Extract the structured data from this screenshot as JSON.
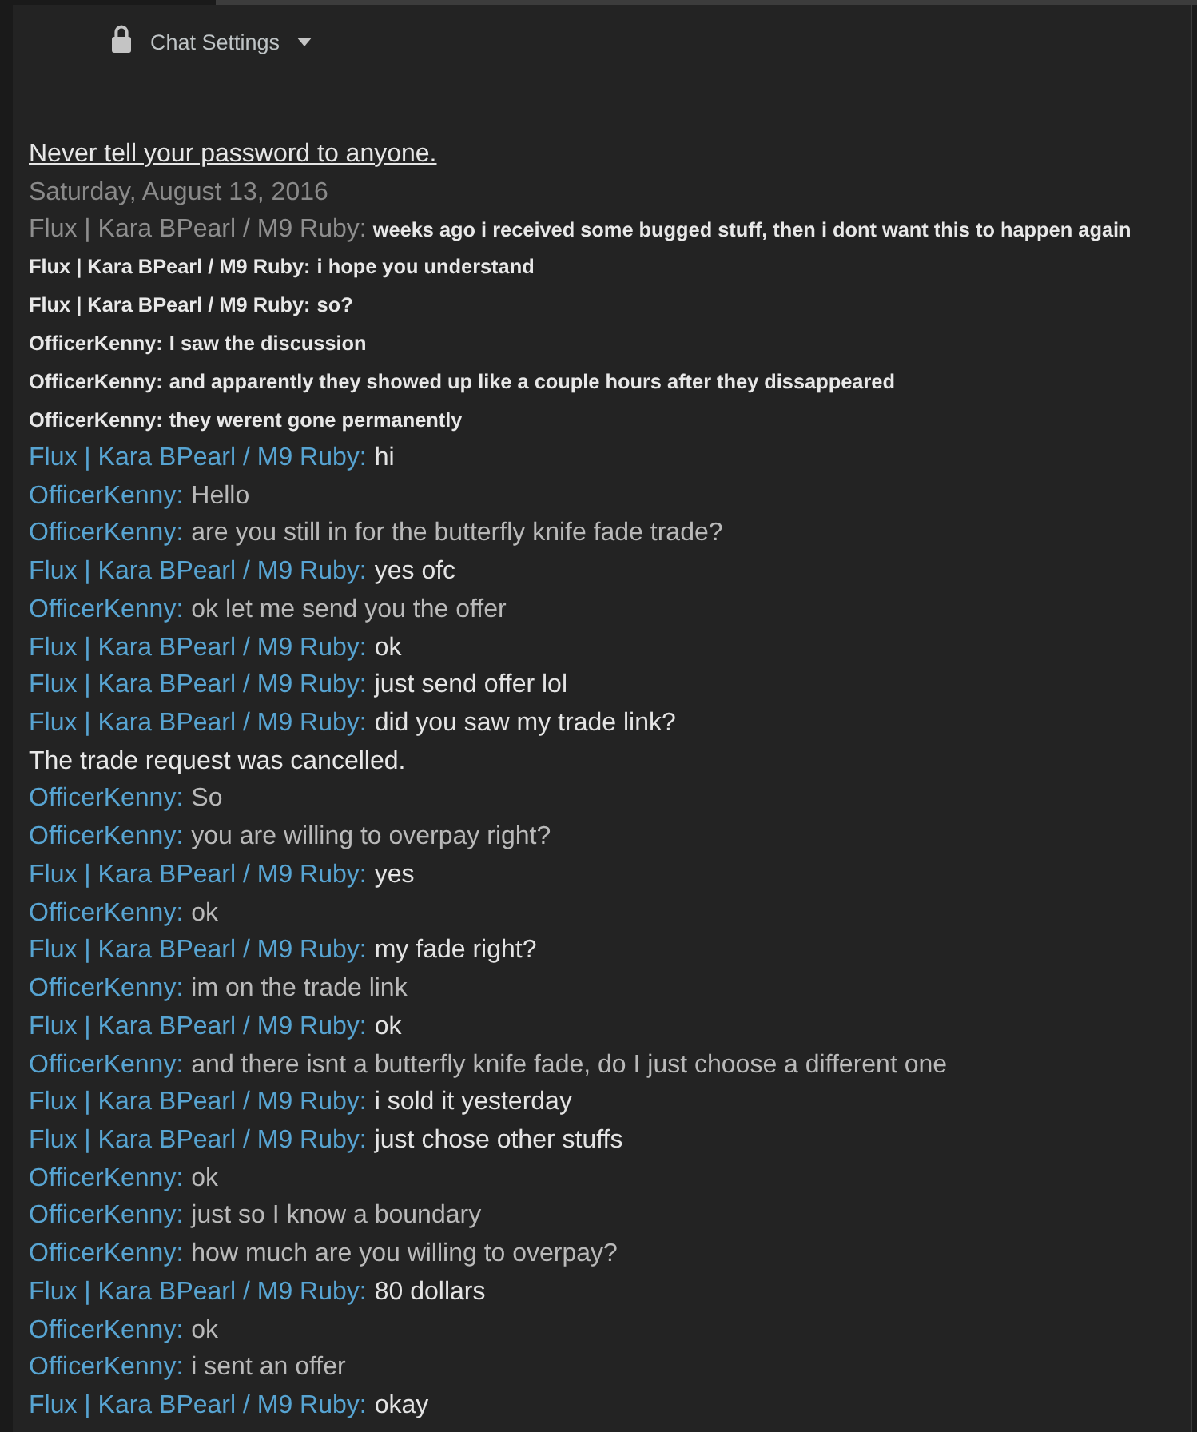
{
  "header": {
    "settings_label": "Chat Settings"
  },
  "warning": "Never tell your password to anyone.",
  "date": "Saturday, August 13, 2016",
  "messages": [
    {
      "kind": "history_lead",
      "sender": "Flux | Kara BPearl / M9 Ruby:",
      "text": "weeks ago i received some bugged stuff, then i dont want this to happen again"
    },
    {
      "kind": "history",
      "sender": "Flux | Kara BPearl / M9 Ruby:",
      "text": "i hope you understand"
    },
    {
      "kind": "history",
      "sender": "Flux | Kara BPearl / M9 Ruby:",
      "text": "so?"
    },
    {
      "kind": "history",
      "sender": "OfficerKenny:",
      "text": "I saw the discussion"
    },
    {
      "kind": "history",
      "sender": "OfficerKenny:",
      "text": "and apparently they showed up like a couple hours after they dissappeared"
    },
    {
      "kind": "history",
      "sender": "OfficerKenny:",
      "text": "they werent gone permanently"
    },
    {
      "kind": "self",
      "sender": "Flux | Kara BPearl / M9 Ruby:",
      "text": "hi"
    },
    {
      "kind": "friend",
      "sender": "OfficerKenny:",
      "text": "Hello"
    },
    {
      "kind": "friend",
      "sender": "OfficerKenny:",
      "text": "are you still in for the butterfly knife fade trade?"
    },
    {
      "kind": "self",
      "sender": "Flux | Kara BPearl / M9 Ruby:",
      "text": "yes ofc"
    },
    {
      "kind": "friend",
      "sender": "OfficerKenny:",
      "text": "ok let me send you the offer"
    },
    {
      "kind": "self",
      "sender": "Flux | Kara BPearl / M9 Ruby:",
      "text": "ok"
    },
    {
      "kind": "self",
      "sender": "Flux | Kara BPearl / M9 Ruby:",
      "text": "just send offer lol"
    },
    {
      "kind": "self",
      "sender": "Flux | Kara BPearl / M9 Ruby:",
      "text": "did you saw my trade link?"
    },
    {
      "kind": "notice",
      "text": "The trade request was cancelled."
    },
    {
      "kind": "friend",
      "sender": "OfficerKenny:",
      "text": "So"
    },
    {
      "kind": "friend",
      "sender": "OfficerKenny:",
      "text": "you are willing to overpay right?"
    },
    {
      "kind": "self",
      "sender": "Flux | Kara BPearl / M9 Ruby:",
      "text": "yes"
    },
    {
      "kind": "friend",
      "sender": "OfficerKenny:",
      "text": "ok"
    },
    {
      "kind": "self",
      "sender": "Flux | Kara BPearl / M9 Ruby:",
      "text": "my fade right?"
    },
    {
      "kind": "friend",
      "sender": "OfficerKenny:",
      "text": "im on the trade link"
    },
    {
      "kind": "self",
      "sender": "Flux | Kara BPearl / M9 Ruby:",
      "text": "ok"
    },
    {
      "kind": "friend",
      "sender": "OfficerKenny:",
      "text": "and there isnt a butterfly knife fade, do I just choose a different one"
    },
    {
      "kind": "self",
      "sender": "Flux | Kara BPearl / M9 Ruby:",
      "text": "i sold it yesterday"
    },
    {
      "kind": "self",
      "sender": "Flux | Kara BPearl / M9 Ruby:",
      "text": "just chose other stuffs"
    },
    {
      "kind": "friend",
      "sender": "OfficerKenny:",
      "text": "ok"
    },
    {
      "kind": "friend",
      "sender": "OfficerKenny:",
      "text": "just so I know a boundary"
    },
    {
      "kind": "friend",
      "sender": "OfficerKenny:",
      "text": "how much are you willing to overpay?"
    },
    {
      "kind": "self",
      "sender": "Flux | Kara BPearl / M9 Ruby:",
      "text": "80 dollars"
    },
    {
      "kind": "friend",
      "sender": "OfficerKenny:",
      "text": "ok"
    },
    {
      "kind": "friend",
      "sender": "OfficerKenny:",
      "text": "i sent an offer"
    },
    {
      "kind": "self",
      "sender": "Flux | Kara BPearl / M9 Ruby:",
      "text": "okay"
    }
  ]
}
